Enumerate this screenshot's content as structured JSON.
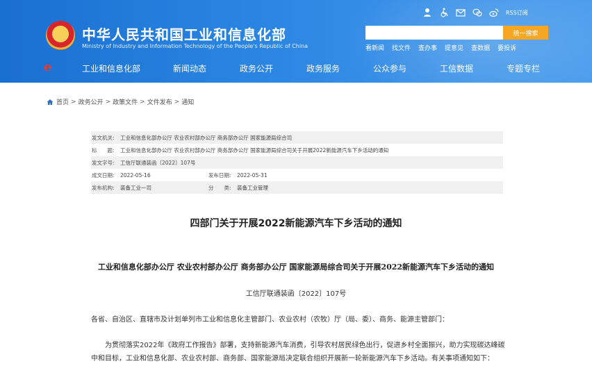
{
  "header": {
    "site_title": "中华人民共和国工业和信息化部",
    "site_subtitle": "Ministry of Industry and Information Technology of the People's Republic of China",
    "rss_label": "RSS订阅",
    "search_placeholder": "",
    "search_button": "统一搜索",
    "quick_links": [
      "看新闻",
      "找文件",
      "查办事",
      "提意见",
      "查数据",
      "要投诉"
    ],
    "top_icons": [
      "elder-mode-icon",
      "accessibility-icon",
      "mail-icon",
      "weixin-icon",
      "weibo-icon"
    ]
  },
  "nav": {
    "items": [
      "工业和信息化部",
      "新闻动态",
      "政务公开",
      "政务服务",
      "公众参与",
      "工信数据",
      "专题专栏"
    ]
  },
  "breadcrumb": [
    "首页",
    "政务公开",
    "政策文件",
    "文件发布",
    "通知"
  ],
  "info": {
    "issuer_label": "发文机关:",
    "issuer": "工业和信息化部办公厅 农业农村部办公厅 商务部办公厅 国家能源局综合司",
    "title_label": "标　　题:",
    "title": "工业和信息化部办公厅 农业农村部办公厅 商务部办公厅 国家能源局综合司关于开展2022新能源汽车下乡活动的通知",
    "docno_label": "发文字号:",
    "docno": "工信厅联通装函〔2022〕107号",
    "created_label": "成文日期:",
    "created": "2022-05-16",
    "published_label": "发布日期:",
    "published": "2022-05-31",
    "org_label": "发布机构:",
    "org": "装备工业一司",
    "category_label": "分　　类:",
    "category": "装备工业管理"
  },
  "article": {
    "title": "四部门关于开展2022新能源汽车下乡活动的通知",
    "headline": "工业和信息化部办公厅 农业农村部办公厅 商务部办公厅 国家能源局综合司关于开展2022新能源汽车下乡活动的通知",
    "docno": "工信厅联通装函〔2022〕107号",
    "addressee": "各省、自治区、直辖市及计划单列市工业和信息化主管部门、农业农村（农牧）厅（局、委）、商务、能源主管部门：",
    "paragraph": "为贯彻落实2022年《政府工作报告》部署，支持新能源汽车消费，引导农村居民绿色出行，促进乡村全面振兴，助力实现碳达峰碳中和目标，工业和信息化部、农业农村部、商务部、国家能源局决定联合组织开展新一轮新能源汽车下乡活动。有关事项通知如下："
  },
  "colors": {
    "header_blue": "#2b86e3",
    "search_orange": "#f5a623",
    "logo_red": "#e53a2f"
  }
}
